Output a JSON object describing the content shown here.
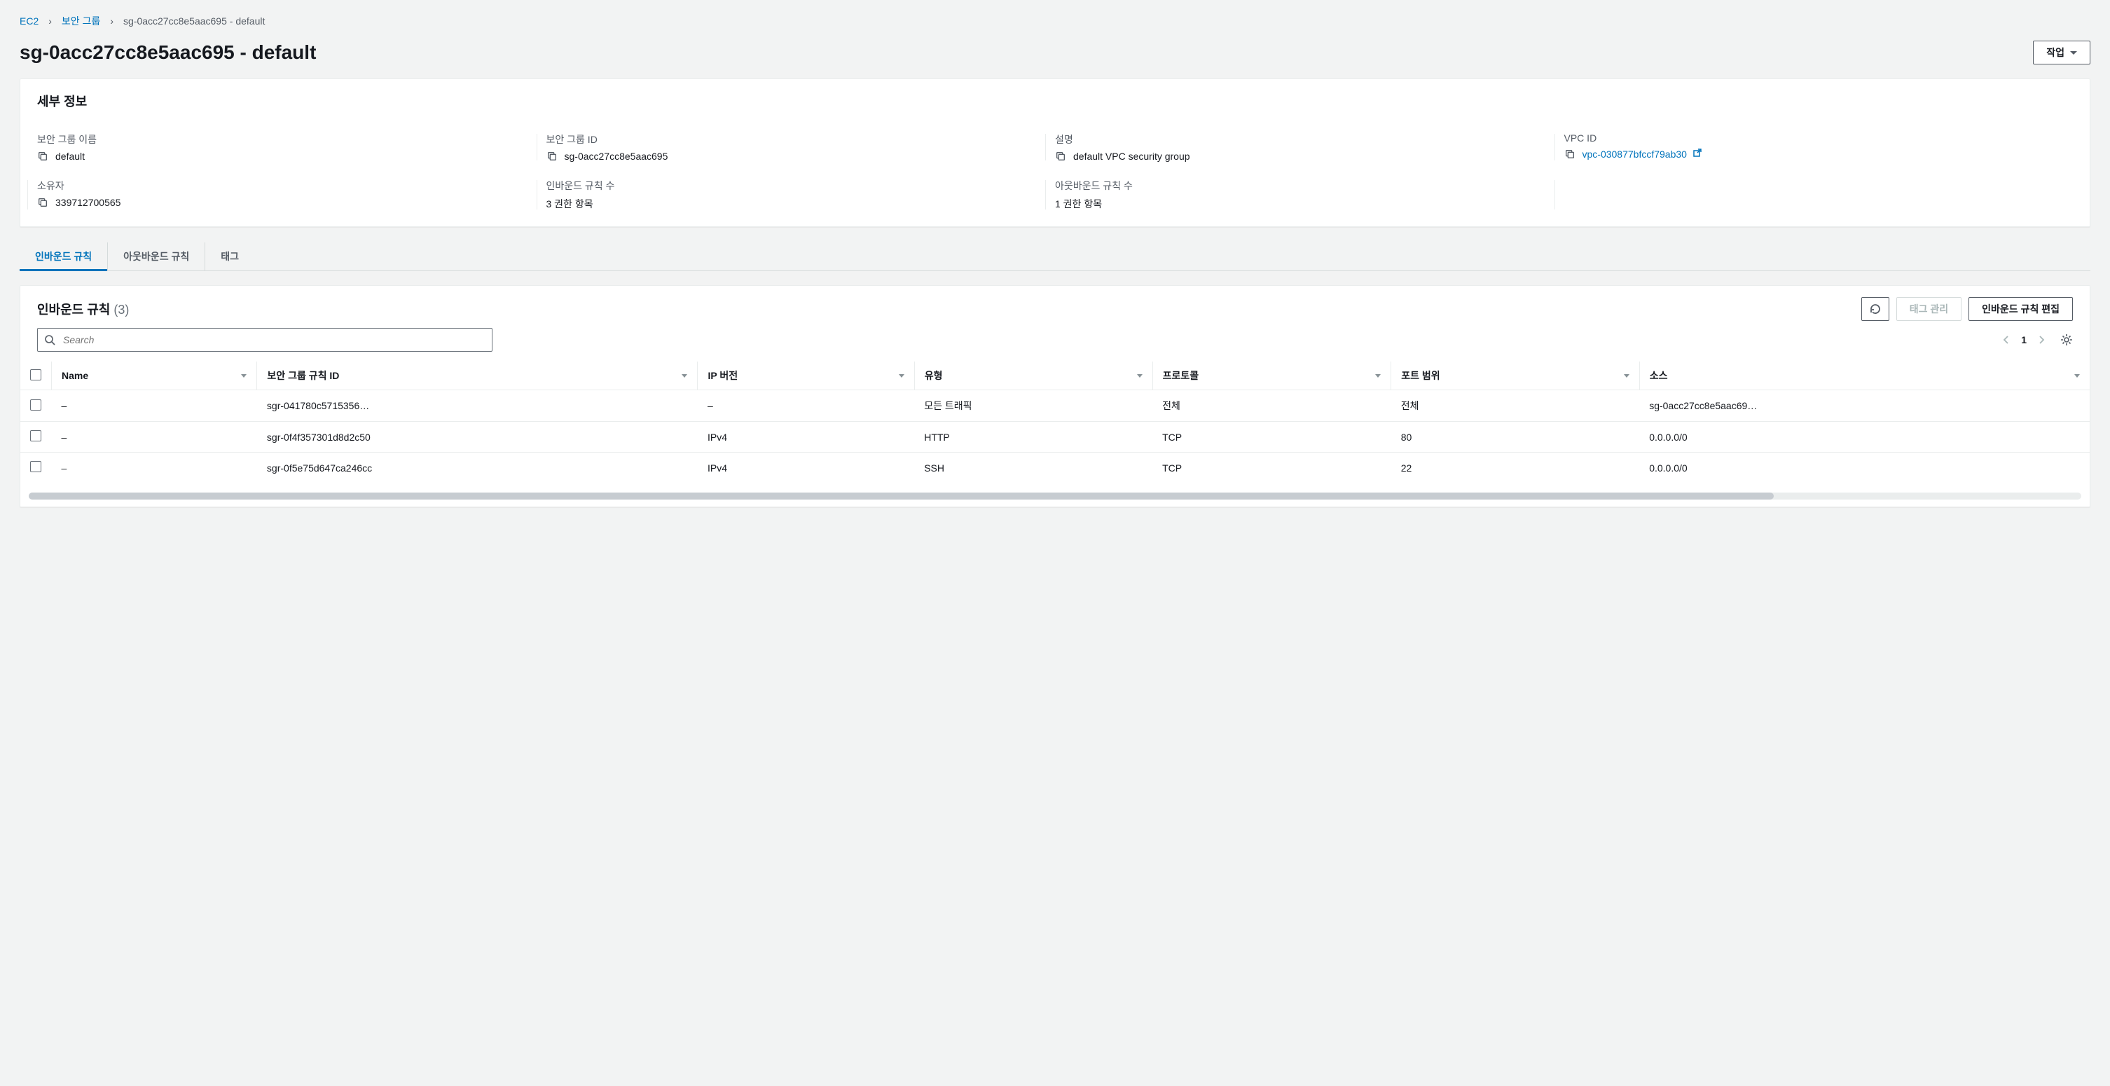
{
  "breadcrumb": {
    "root": "EC2",
    "section": "보안 그룹",
    "current": "sg-0acc27cc8e5aac695 - default"
  },
  "header": {
    "title": "sg-0acc27cc8e5aac695 - default",
    "actions_label": "작업"
  },
  "details": {
    "panel_title": "세부 정보",
    "fields": {
      "sg_name": {
        "label": "보안 그룹 이름",
        "value": "default"
      },
      "sg_id": {
        "label": "보안 그룹 ID",
        "value": "sg-0acc27cc8e5aac695"
      },
      "desc": {
        "label": "설명",
        "value": "default VPC security group"
      },
      "vpc_id": {
        "label": "VPC ID",
        "value": "vpc-030877bfccf79ab30"
      },
      "owner": {
        "label": "소유자",
        "value": "339712700565"
      },
      "inbound_count": {
        "label": "인바운드 규칙 수",
        "value": "3 권한 항목"
      },
      "outbound_count": {
        "label": "아웃바운드 규칙 수",
        "value": "1 권한 항목"
      }
    }
  },
  "tabs": [
    {
      "id": "inbound",
      "label": "인바운드 규칙",
      "active": true
    },
    {
      "id": "outbound",
      "label": "아웃바운드 규칙",
      "active": false
    },
    {
      "id": "tags",
      "label": "태그",
      "active": false
    }
  ],
  "rules": {
    "title": "인바운드 규칙",
    "count_display": "(3)",
    "manage_tags_label": "태그 관리",
    "edit_label": "인바운드 규칙 편집",
    "search_placeholder": "Search",
    "page": "1",
    "columns": [
      "Name",
      "보안 그룹 규칙 ID",
      "IP 버전",
      "유형",
      "프로토콜",
      "포트 범위",
      "소스"
    ],
    "rows": [
      {
        "name": "–",
        "rule_id": "sgr-041780c5715356…",
        "ip_ver": "–",
        "type": "모든 트래픽",
        "protocol": "전체",
        "port": "전체",
        "source": "sg-0acc27cc8e5aac69…"
      },
      {
        "name": "–",
        "rule_id": "sgr-0f4f357301d8d2c50",
        "ip_ver": "IPv4",
        "type": "HTTP",
        "protocol": "TCP",
        "port": "80",
        "source": "0.0.0.0/0"
      },
      {
        "name": "–",
        "rule_id": "sgr-0f5e75d647ca246cc",
        "ip_ver": "IPv4",
        "type": "SSH",
        "protocol": "TCP",
        "port": "22",
        "source": "0.0.0.0/0"
      }
    ]
  }
}
